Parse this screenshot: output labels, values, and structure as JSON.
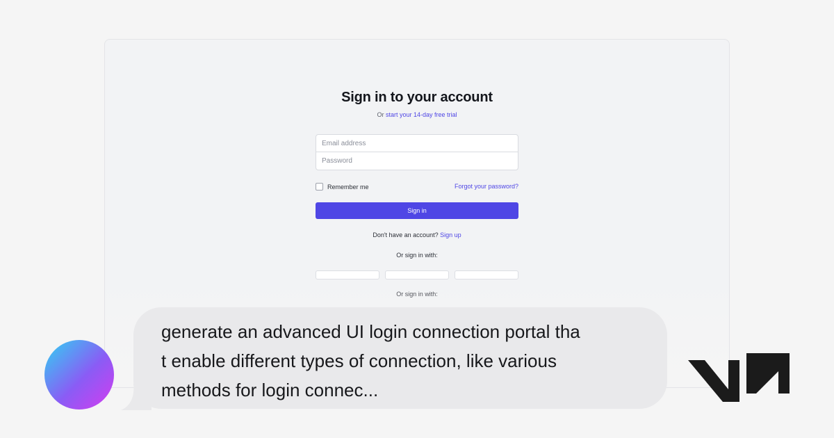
{
  "login": {
    "title": "Sign in to your account",
    "subtitle_prefix": "Or ",
    "subtitle_link": "start your 14-day free trial",
    "email_placeholder": "Email address",
    "password_placeholder": "Password",
    "remember_label": "Remember me",
    "forgot_link": "Forgot your password?",
    "signin_button": "Sign in",
    "no_account_text": "Don't have an account? ",
    "signup_link": "Sign up",
    "or_sign_in_with_1": "Or sign in with:",
    "or_sign_in_with_2": "Or sign in with:"
  },
  "chat": {
    "message": "generate an advanced UI login connection portal tha\nt enable different types of connection, like various\nmethods for login connec..."
  },
  "colors": {
    "accent": "#4f46e5",
    "avatar_gradient": [
      "#2fd3f2",
      "#8a5cf5",
      "#d43cf0"
    ],
    "bubble": "#e9e9eb"
  },
  "icons": {
    "avatar": "gradient-avatar",
    "logo": "v0-logo"
  }
}
